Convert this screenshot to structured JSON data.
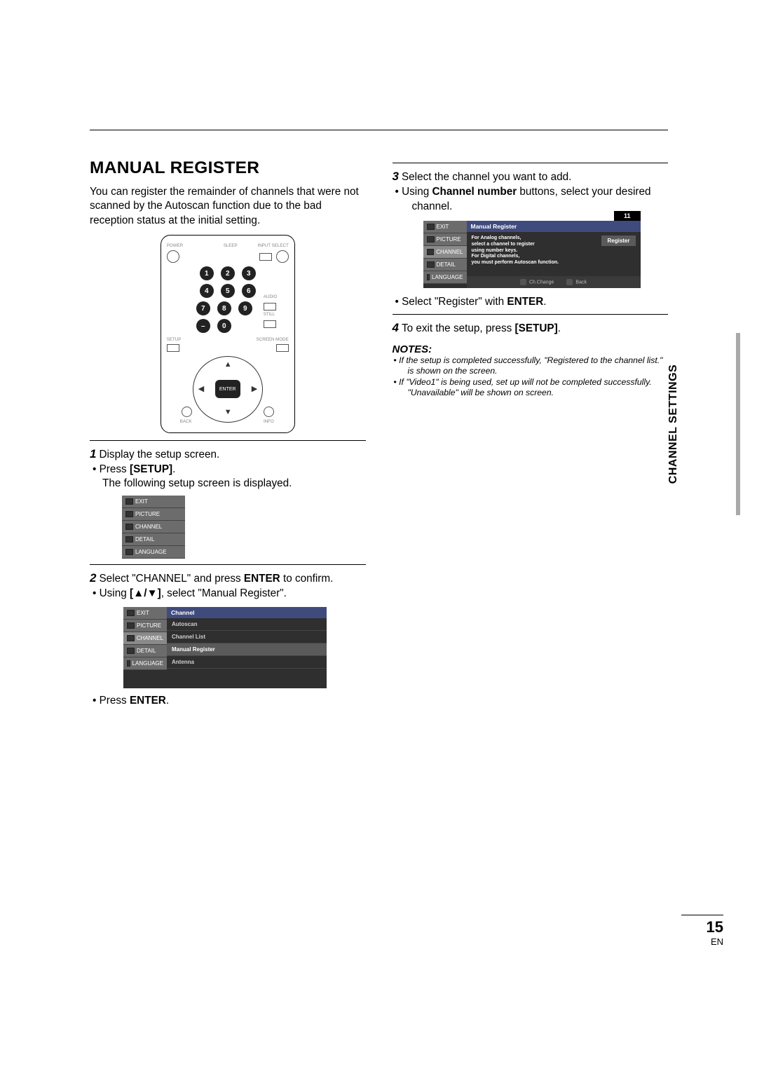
{
  "header_tab": "CHANNEL SETTINGS",
  "page_number": "15",
  "page_lang": "EN",
  "title": "MANUAL REGISTER",
  "intro": "You can register the remainder of channels that were not scanned by the Autoscan function due to the bad reception status at the initial setting.",
  "remote": {
    "labels": {
      "power": "POWER",
      "sleep": "SLEEP",
      "input": "INPUT SELECT",
      "audio": "AUDIO",
      "still": "STILL",
      "setup": "SETUP",
      "screen": "SCREEN MODE",
      "back": "BACK",
      "info": "INFO",
      "enter": "ENTER"
    },
    "numbers": [
      "1",
      "2",
      "3",
      "4",
      "5",
      "6",
      "7",
      "8",
      "9",
      "–",
      "0"
    ]
  },
  "left": {
    "step1": "Display the setup screen.",
    "step1_b1_pre": "Press ",
    "step1_b1_key": "[SETUP]",
    "step1_b1_post": ".",
    "step1_after": "The following setup screen is displayed.",
    "step2_pre": "Select \"CHANNEL\" and press ",
    "step2_key": "ENTER",
    "step2_post": " to confirm.",
    "step2_b1_pre": "Using ",
    "step2_b1_key": "[▲/▼]",
    "step2_b1_post": ", select \"Manual Register\".",
    "step2_b2_pre": "Press ",
    "step2_b2_key": "ENTER",
    "step2_b2_post": "."
  },
  "right": {
    "step3": "Select the channel you want to add.",
    "step3_b1_pre": "Using ",
    "step3_b1_key": "Channel number",
    "step3_b1_post": " buttons, select your desired channel.",
    "step3_b2_pre": "Select \"Register\" with ",
    "step3_b2_key": "ENTER",
    "step3_b2_post": ".",
    "step4_pre": "To exit the setup, press ",
    "step4_key": "[SETUP]",
    "step4_post": ".",
    "notes_hd": "NOTES:",
    "note1": "If the setup is completed successfully, \"Registered to the channel list.\" is shown on the screen.",
    "note2": "If \"Video1\" is being used, set up will not be completed successfully. \"Unavailable\" will be shown on screen."
  },
  "osd": {
    "menu_items": [
      "EXIT",
      "PICTURE",
      "CHANNEL",
      "DETAIL",
      "LANGUAGE"
    ],
    "channel_hd": "Channel",
    "channel_rows": [
      "Autoscan",
      "Channel List",
      "Manual Register",
      "Antenna"
    ],
    "mr_hd": "Manual Register",
    "mr_info_l1": "For Analog channels,",
    "mr_info_l2": "select a channel to register",
    "mr_info_l3": "using number keys.",
    "mr_info_l4": "For Digital channels,",
    "mr_info_l5": "you must perform Autoscan function.",
    "register_btn": "Register",
    "ch_number": "11",
    "foot_change": "Ch.Change",
    "foot_back": "Back"
  }
}
